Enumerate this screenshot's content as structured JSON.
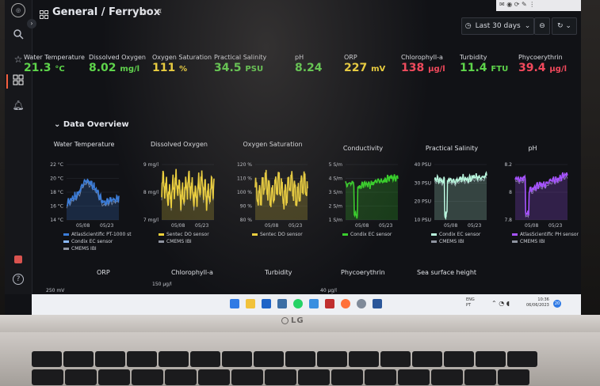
{
  "header": {
    "title": "General / Ferrybox",
    "time_range": "Last 30 days"
  },
  "stats": [
    {
      "label": "Water Temperature",
      "value": "21.3",
      "unit": "°C",
      "color": "#5ed54b"
    },
    {
      "label": "Dissolved Oxygen",
      "value": "8.02",
      "unit": "mg/l",
      "color": "#5ed54b"
    },
    {
      "label": "Oxygen Saturation",
      "value": "111",
      "unit": "%",
      "color": "#f2d43a"
    },
    {
      "label": "Practical Salinity",
      "value": "34.5",
      "unit": "PSU",
      "color": "#5ed54b"
    },
    {
      "label": "pH",
      "value": "8.24",
      "unit": "",
      "color": "#5ed54b"
    },
    {
      "label": "ORP",
      "value": "227",
      "unit": "mV",
      "color": "#f2d43a"
    },
    {
      "label": "Chlorophyll-a",
      "value": "138",
      "unit": "µg/l",
      "color": "#f2495c"
    },
    {
      "label": "Turbidity",
      "value": "11.4",
      "unit": "FTU",
      "color": "#5ed54b"
    },
    {
      "label": "Phycoerythrin",
      "value": "39.4",
      "unit": "µg/l",
      "color": "#f2495c"
    }
  ],
  "section": {
    "title": "Data Overview"
  },
  "panels": [
    {
      "title": "Water Temperature",
      "yticks": [
        "22 °C",
        "20 °C",
        "18 °C",
        "16 °C",
        "14 °C"
      ],
      "xticks": [
        "05/08",
        "05/23"
      ],
      "legend": [
        "AtlasScientific PT-1000 st",
        "Condix EC sensor",
        "CMEMS IBI"
      ],
      "colors": [
        "#3c7dd9",
        "#8ab8ff",
        "#8f94a0"
      ]
    },
    {
      "title": "Dissolved Oxygen",
      "yticks": [
        "9 mg/l",
        "8 mg/l",
        "7 mg/l"
      ],
      "xticks": [
        "05/08",
        "05/23"
      ],
      "legend": [
        "Sentec DO sensor",
        "CMEMS IBI"
      ],
      "colors": [
        "#f2d43a",
        "#8f94a0"
      ]
    },
    {
      "title": "Oxygen Saturation",
      "yticks": [
        "120 %",
        "110 %",
        "100 %",
        "90 %",
        "80 %"
      ],
      "xticks": [
        "05/08",
        "05/23"
      ],
      "legend": [
        "Sentec DO sensor"
      ],
      "colors": [
        "#f2d43a"
      ]
    },
    {
      "title": "Conductivity",
      "yticks": [
        "5 S/m",
        "4 S/m",
        "3 S/m",
        "2 S/m",
        "1 S/m"
      ],
      "xticks": [
        "05/08",
        "05/23"
      ],
      "legend": [
        "Condix EC sensor"
      ],
      "colors": [
        "#37d12a"
      ]
    },
    {
      "title": "Practical Salinity",
      "yticks": [
        "40 PSU",
        "30 PSU",
        "20 PSU",
        "10 PSU"
      ],
      "xticks": [
        "05/08",
        "05/23"
      ],
      "legend": [
        "Condix EC sensor",
        "CMEMS IBI"
      ],
      "colors": [
        "#b8f5dc",
        "#8f94a0"
      ]
    },
    {
      "title": "pH",
      "yticks": [
        "8.2",
        "8",
        "7.8"
      ],
      "xticks": [
        "05/08",
        "05/23"
      ],
      "legend": [
        "AtlasScientific PH sensor",
        "CMEMS IBI"
      ],
      "colors": [
        "#a653ff",
        "#8f94a0"
      ]
    }
  ],
  "row2": [
    "ORP",
    "Chlorophyll-a",
    "Turbidity",
    "Phycoerythrin",
    "Sea surface height"
  ],
  "row2_ticks": {
    "orp": "250 mV",
    "chl": "150 µg/l",
    "phy": "40 µg/l"
  },
  "taskbar": {
    "lang": "ENG",
    "region": "PT",
    "time": "10:36",
    "date": "06/06/2023",
    "badge": "20"
  },
  "brand": "LG"
}
